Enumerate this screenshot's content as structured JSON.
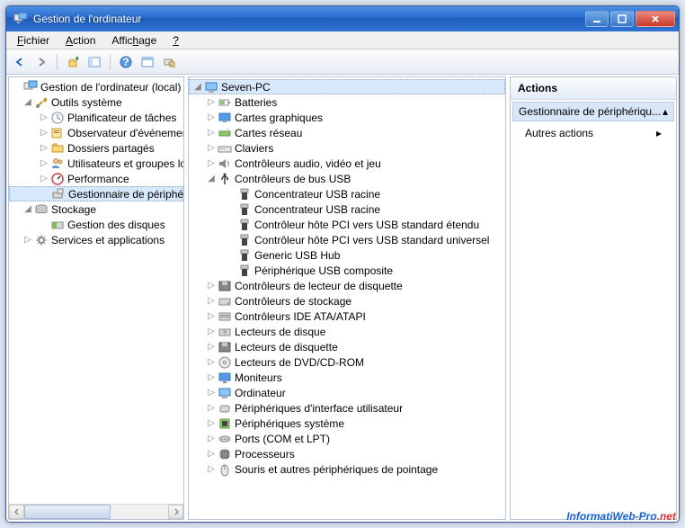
{
  "window": {
    "title": "Gestion de l'ordinateur"
  },
  "menu": {
    "file": "Fichier",
    "action": "Action",
    "view": "Affichage",
    "help": "?"
  },
  "tree_left": {
    "root": "Gestion de l'ordinateur (local)",
    "systools": "Outils système",
    "systools_children": [
      "Planificateur de tâches",
      "Observateur d'événements",
      "Dossiers partagés",
      "Utilisateurs et groupes locaux",
      "Performance",
      "Gestionnaire de périphériques"
    ],
    "storage": "Stockage",
    "storage_children": [
      "Gestion des disques"
    ],
    "services": "Services et applications"
  },
  "tree_mid": {
    "root": "Seven-PC",
    "cats": [
      "Batteries",
      "Cartes graphiques",
      "Cartes réseau",
      "Claviers",
      "Contrôleurs audio, vidéo et jeu",
      "Contrôleurs de bus USB",
      "Contrôleurs de lecteur de disquette",
      "Contrôleurs de stockage",
      "Contrôleurs IDE ATA/ATAPI",
      "Lecteurs de disque",
      "Lecteurs de disquette",
      "Lecteurs de DVD/CD-ROM",
      "Moniteurs",
      "Ordinateur",
      "Périphériques d'interface utilisateur",
      "Périphériques système",
      "Ports (COM et LPT)",
      "Processeurs",
      "Souris et autres périphériques de pointage"
    ],
    "usb": [
      "Concentrateur USB racine",
      "Concentrateur USB racine",
      "Contrôleur hôte PCI vers USB standard étendu",
      "Contrôleur hôte PCI vers USB standard universel",
      "Generic USB Hub",
      "Périphérique USB composite"
    ]
  },
  "actions": {
    "header": "Actions",
    "sub": "Gestionnaire de périphériqu...",
    "more": "Autres actions"
  },
  "watermark": {
    "a": "InformatiWeb-Pro",
    "b": ".net"
  }
}
